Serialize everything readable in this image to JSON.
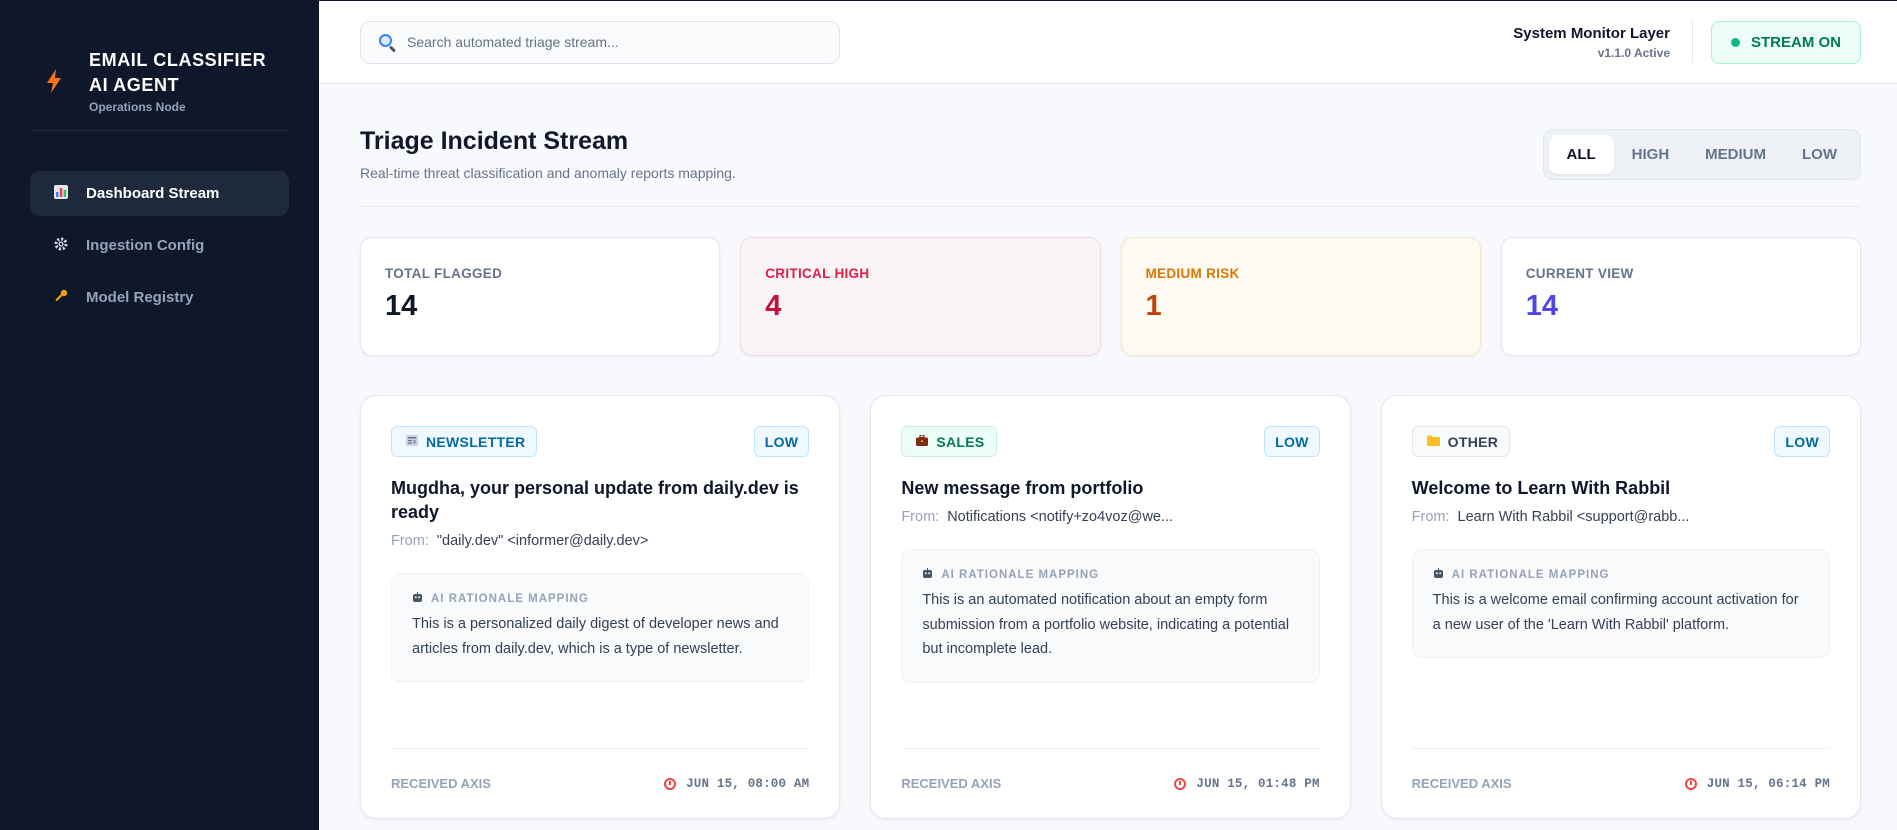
{
  "brand": {
    "title": "EMAIL CLASSIFIER AI AGENT",
    "subtitle": "Operations Node",
    "icon": "lightning-icon"
  },
  "nav": [
    {
      "label": "Dashboard Stream",
      "icon": "bar-chart-icon",
      "active": true
    },
    {
      "label": "Ingestion Config",
      "icon": "gear-icon",
      "active": false
    },
    {
      "label": "Model Registry",
      "icon": "key-icon",
      "active": false
    }
  ],
  "search": {
    "placeholder": "Search automated triage stream..."
  },
  "system": {
    "title": "System Monitor Layer",
    "version": "v1.1.0 Active",
    "stream_label": "STREAM ON"
  },
  "header": {
    "title": "Triage Incident Stream",
    "subtitle": "Real-time threat classification and anomaly reports mapping."
  },
  "filters": [
    "ALL",
    "HIGH",
    "MEDIUM",
    "LOW"
  ],
  "stats": [
    {
      "label": "TOTAL FLAGGED",
      "value": "14"
    },
    {
      "label": "CRITICAL HIGH",
      "value": "4"
    },
    {
      "label": "MEDIUM RISK",
      "value": "1"
    },
    {
      "label": "CURRENT VIEW",
      "value": "14"
    }
  ],
  "cards": [
    {
      "tag": "NEWSLETTER",
      "tag_icon": "newspaper-icon",
      "level": "LOW",
      "title": "Mugdha, your personal update from daily.dev is ready",
      "from_label": "From:",
      "from": "\"daily.dev\" <informer@daily.dev>",
      "rationale_label": "AI RATIONALE MAPPING",
      "rationale": "This is a personalized daily digest of developer news and articles from daily.dev, which is a type of newsletter.",
      "foot_label": "RECEIVED AXIS",
      "time": "JUN 15, 08:00 AM"
    },
    {
      "tag": "SALES",
      "tag_icon": "briefcase-icon",
      "level": "LOW",
      "title": "New message from portfolio",
      "from_label": "From:",
      "from": "Notifications <notify+zo4voz@we...",
      "rationale_label": "AI RATIONALE MAPPING",
      "rationale": "This is an automated notification about an empty form submission from a portfolio website, indicating a potential but incomplete lead.",
      "foot_label": "RECEIVED AXIS",
      "time": "JUN 15, 01:48 PM"
    },
    {
      "tag": "OTHER",
      "tag_icon": "folder-icon",
      "level": "LOW",
      "title": "Welcome to Learn With Rabbil",
      "from_label": "From:",
      "from": "Learn With Rabbil <support@rabb...",
      "rationale_label": "AI RATIONALE MAPPING",
      "rationale": "This is a welcome email confirming account activation for a new user of the 'Learn With Rabbil' platform.",
      "foot_label": "RECEIVED AXIS",
      "time": "JUN 15, 06:14 PM"
    }
  ]
}
